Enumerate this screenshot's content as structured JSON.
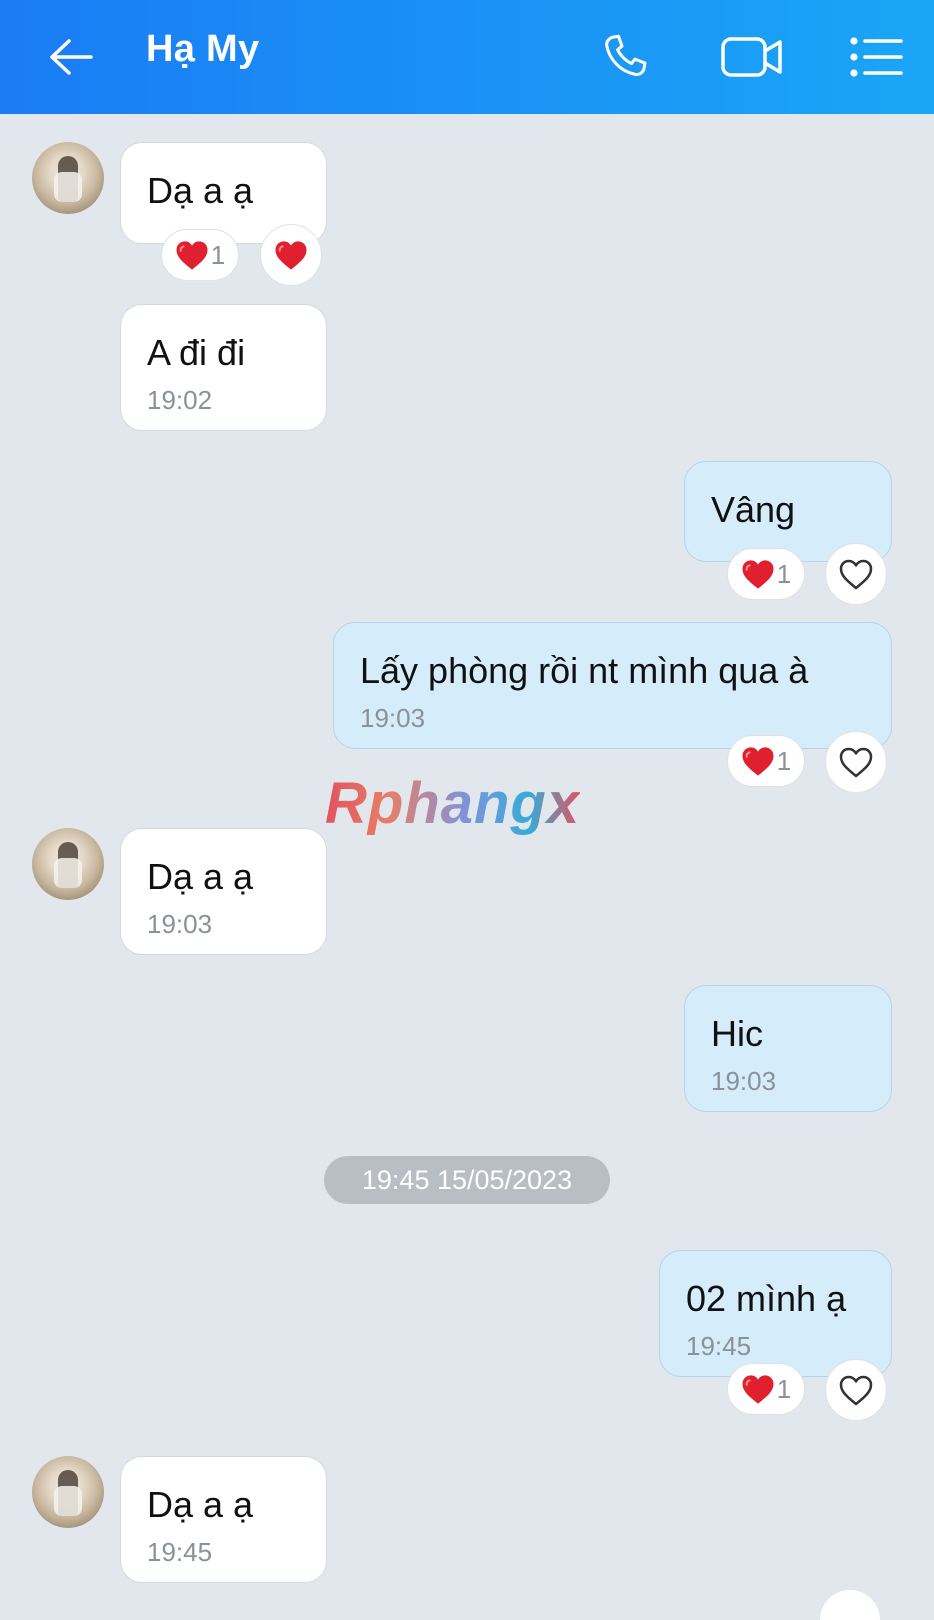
{
  "header": {
    "back_icon": "arrow-left-icon",
    "contact_name": "Hạ My",
    "call_icon": "phone-icon",
    "video_icon": "video-camera-icon",
    "menu_icon": "list-menu-icon",
    "gradient_from": "#1a7cf5",
    "gradient_to": "#1aa6f6"
  },
  "messages": [
    {
      "side": "incoming",
      "text": "Dạ a ạ",
      "reaction_count": "1"
    },
    {
      "side": "incoming",
      "text": "A đi đi",
      "time": "19:02"
    },
    {
      "side": "outgoing",
      "text": "Vâng",
      "reaction_count": "1"
    },
    {
      "side": "outgoing",
      "text": "Lấy phòng rồi nt mình qua à",
      "time": "19:03",
      "reaction_count": "1"
    },
    {
      "side": "incoming",
      "text": "Dạ a ạ",
      "time": "19:03"
    },
    {
      "side": "outgoing",
      "text": "Hic",
      "time": "19:03"
    },
    {
      "side": "outgoing",
      "text": "02 mình ạ",
      "time": "19:45",
      "reaction_count": "1"
    },
    {
      "side": "incoming",
      "text": "Dạ a ạ",
      "time": "19:45"
    }
  ],
  "date_separator": "19:45 15/05/2023",
  "watermark": "Rphangx",
  "colors": {
    "incoming_bubble": "#ffffff",
    "outgoing_bubble": "#d5ecfb",
    "background": "#e2e7ee",
    "heart": "#e0202e"
  }
}
